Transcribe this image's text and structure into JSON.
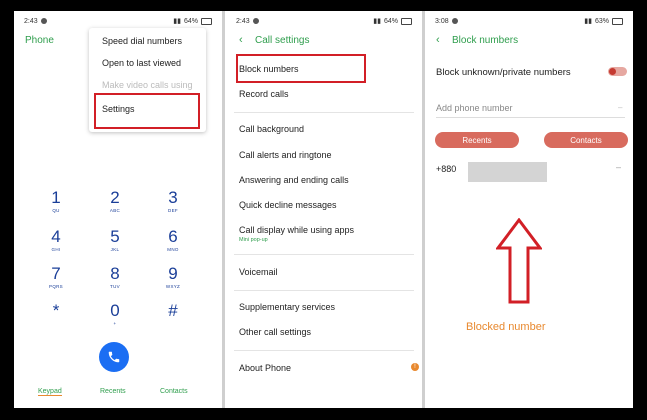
{
  "panel1": {
    "status_time": "2:43",
    "status_battery": "64%",
    "title": "Phone",
    "menu": {
      "item1": "Speed dial numbers",
      "item2": "Open to last viewed",
      "item3": "Make video calls using",
      "item4": "Settings"
    },
    "keypad": [
      {
        "digit": "1",
        "letters": "QU"
      },
      {
        "digit": "2",
        "letters": "ABC"
      },
      {
        "digit": "3",
        "letters": "DEF"
      },
      {
        "digit": "4",
        "letters": "GHI"
      },
      {
        "digit": "5",
        "letters": "JKL"
      },
      {
        "digit": "6",
        "letters": "MNO"
      },
      {
        "digit": "7",
        "letters": "PQRS"
      },
      {
        "digit": "8",
        "letters": "TUV"
      },
      {
        "digit": "9",
        "letters": "WXYZ"
      },
      {
        "digit": "*",
        "letters": ""
      },
      {
        "digit": "0",
        "letters": "+"
      },
      {
        "digit": "#",
        "letters": ""
      }
    ],
    "tabs": {
      "keypad": "Keypad",
      "recents": "Recents",
      "contacts": "Contacts"
    }
  },
  "panel2": {
    "status_time": "2:43",
    "status_battery": "64%",
    "title": "Call settings",
    "items": {
      "block": "Block numbers",
      "record": "Record calls",
      "background": "Call background",
      "alerts": "Call alerts and ringtone",
      "answering": "Answering and ending calls",
      "quick_decline": "Quick decline messages",
      "call_display": "Call display while using apps",
      "call_display_sub": "Mini pop-up",
      "voicemail": "Voicemail",
      "supplementary": "Supplementary services",
      "other": "Other call settings",
      "about": "About Phone"
    }
  },
  "panel3": {
    "status_time": "3:08",
    "status_battery": "63%",
    "title": "Block numbers",
    "block_unknown": "Block unknown/private numbers",
    "add_placeholder": "Add phone number",
    "recents_btn": "Recents",
    "contacts_btn": "Contacts",
    "blocked_prefix": "+880",
    "annotation": "Blocked number"
  },
  "colors": {
    "accent_green": "#2f9e4d",
    "keypad_blue": "#1a3e98",
    "highlight_red": "#d21f26",
    "button_salmon": "#d86b5e",
    "annotation_orange": "#e8892f"
  }
}
